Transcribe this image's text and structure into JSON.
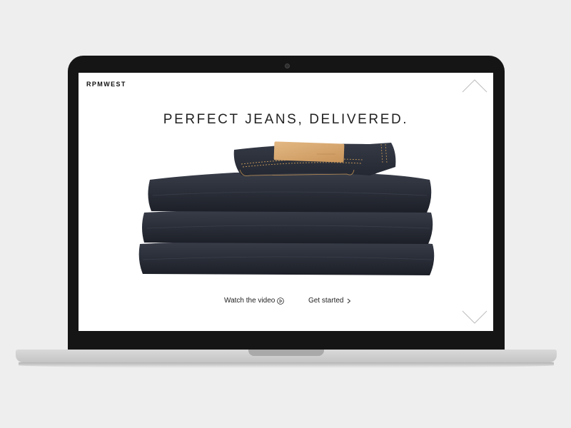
{
  "brand": {
    "logo_text": "RPMWEST"
  },
  "hero": {
    "headline": "PERFECT JEANS, DELIVERED."
  },
  "actions": {
    "watch_video_label": "Watch the video",
    "get_started_label": "Get started"
  },
  "icons": {
    "scroll_up": "chevron-up-outline",
    "scroll_down": "chevron-down-outline",
    "play": "play-circle",
    "arrow": "chevron-right"
  },
  "colors": {
    "page_bg": "#eeeeee",
    "screen_bg": "#ffffff",
    "bezel": "#151515",
    "text": "#222222",
    "denim": "#2f3440",
    "stitch": "#c79a5a",
    "leather_patch": "#d8a974"
  }
}
